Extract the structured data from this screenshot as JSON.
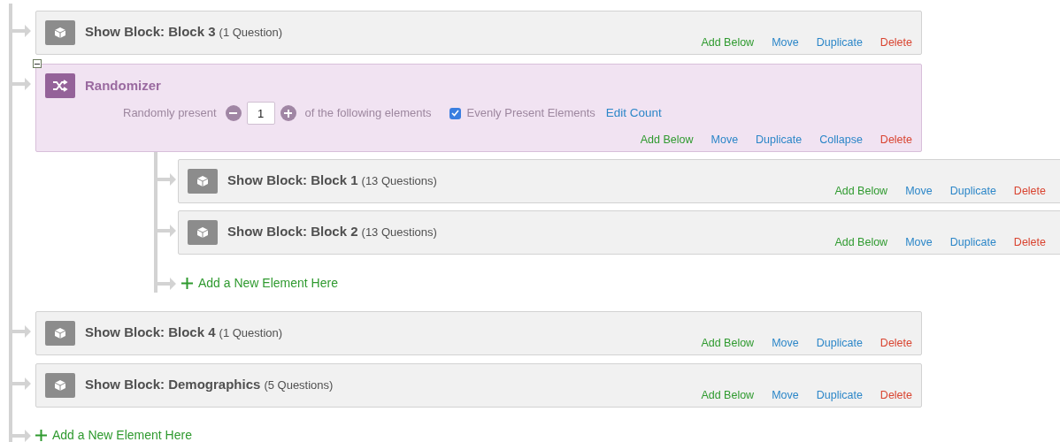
{
  "flow": [
    {
      "kind": "block",
      "title": "Show Block: Block 3",
      "count": "(1 Question)",
      "actions": [
        {
          "kind": "add",
          "label": "Add Below"
        },
        {
          "kind": "move",
          "label": "Move"
        },
        {
          "kind": "duplicate",
          "label": "Duplicate"
        },
        {
          "kind": "delete",
          "label": "Delete"
        }
      ]
    },
    {
      "kind": "randomizer",
      "title": "Randomizer",
      "expanded": true,
      "prefix": "Randomly present",
      "present_count": "1",
      "suffix": "of the following elements",
      "evenly": {
        "label": "Evenly Present Elements",
        "checked": true
      },
      "edit_count": "Edit Count",
      "actions": [
        {
          "kind": "add",
          "label": "Add Below"
        },
        {
          "kind": "move",
          "label": "Move"
        },
        {
          "kind": "duplicate",
          "label": "Duplicate"
        },
        {
          "kind": "collapse",
          "label": "Collapse"
        },
        {
          "kind": "delete",
          "label": "Delete"
        }
      ],
      "children": [
        {
          "kind": "block",
          "title": "Show Block: Block 1",
          "count": "(13 Questions)",
          "actions": [
            {
              "kind": "add",
              "label": "Add Below"
            },
            {
              "kind": "move",
              "label": "Move"
            },
            {
              "kind": "duplicate",
              "label": "Duplicate"
            },
            {
              "kind": "delete",
              "label": "Delete"
            }
          ]
        },
        {
          "kind": "block",
          "title": "Show Block: Block 2",
          "count": "(13 Questions)",
          "actions": [
            {
              "kind": "add",
              "label": "Add Below"
            },
            {
              "kind": "move",
              "label": "Move"
            },
            {
              "kind": "duplicate",
              "label": "Duplicate"
            },
            {
              "kind": "delete",
              "label": "Delete"
            }
          ]
        }
      ],
      "add_element": "Add a New Element Here"
    },
    {
      "kind": "block",
      "title": "Show Block: Block 4",
      "count": "(1 Question)",
      "actions": [
        {
          "kind": "add",
          "label": "Add Below"
        },
        {
          "kind": "move",
          "label": "Move"
        },
        {
          "kind": "duplicate",
          "label": "Duplicate"
        },
        {
          "kind": "delete",
          "label": "Delete"
        }
      ]
    },
    {
      "kind": "block",
      "title": "Show Block: Demographics",
      "count": "(5 Questions)",
      "actions": [
        {
          "kind": "add",
          "label": "Add Below"
        },
        {
          "kind": "move",
          "label": "Move"
        },
        {
          "kind": "duplicate",
          "label": "Duplicate"
        },
        {
          "kind": "delete",
          "label": "Delete"
        }
      ]
    }
  ],
  "add_element": "Add a New Element Here"
}
